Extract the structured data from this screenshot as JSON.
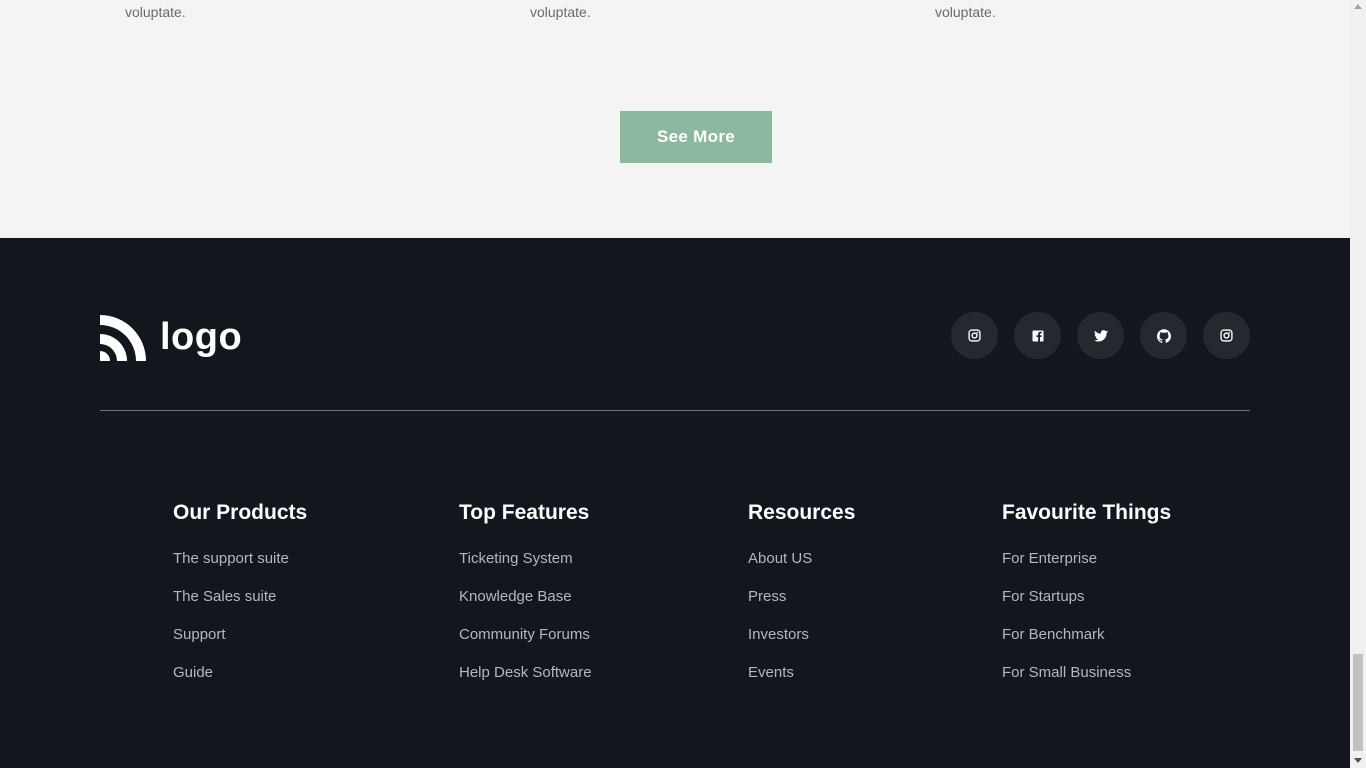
{
  "cards": [
    {
      "text_tail": "voluptate."
    },
    {
      "text_tail": "voluptate."
    },
    {
      "text_tail": "voluptate."
    }
  ],
  "see_more_label": "See More",
  "footer": {
    "logo_text": "logo",
    "socials": [
      {
        "icon": "instagram-icon"
      },
      {
        "icon": "facebook-icon"
      },
      {
        "icon": "twitter-icon"
      },
      {
        "icon": "github-icon"
      },
      {
        "icon": "instagram-icon"
      }
    ],
    "columns": [
      {
        "title": "Our Products",
        "links": [
          "The support suite",
          "The Sales suite",
          "Support",
          "Guide"
        ]
      },
      {
        "title": "Top Features",
        "links": [
          "Ticketing System",
          "Knowledge Base",
          "Community Forums",
          "Help Desk Software"
        ]
      },
      {
        "title": "Resources",
        "links": [
          "About US",
          "Press",
          "Investors",
          "Events"
        ]
      },
      {
        "title": "Favourite Things",
        "links": [
          "For Enterprise",
          "For Startups",
          "For Benchmark",
          "For Small Business"
        ]
      }
    ]
  },
  "colors": {
    "accent": "#8db8a0",
    "footer_bg": "#11171d",
    "page_bg": "#f4f4f4"
  }
}
